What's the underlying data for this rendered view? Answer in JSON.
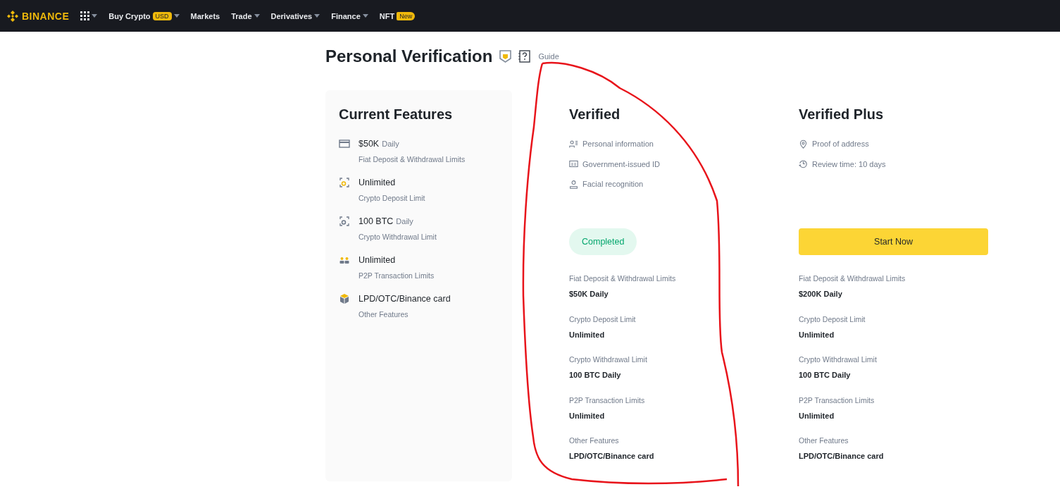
{
  "navbar": {
    "logo": "BINANCE",
    "items": [
      {
        "kind": "apps",
        "caret": true
      },
      {
        "kind": "link",
        "label": "Buy Crypto",
        "badge": "USD",
        "caret": true
      },
      {
        "kind": "link",
        "label": "Markets",
        "caret": false
      },
      {
        "kind": "link",
        "label": "Trade",
        "caret": true
      },
      {
        "kind": "link",
        "label": "Derivatives",
        "caret": true
      },
      {
        "kind": "link",
        "label": "Finance",
        "caret": true
      },
      {
        "kind": "link",
        "label": "NFT",
        "badge": "New",
        "caret": false
      }
    ]
  },
  "page": {
    "title": "Personal Verification",
    "guide": "Guide"
  },
  "current": {
    "title": "Current Features",
    "items": [
      {
        "value": "$50K",
        "suffix": "Daily",
        "label": "Fiat Deposit & Withdrawal Limits"
      },
      {
        "value": "Unlimited",
        "label": "Crypto Deposit Limit"
      },
      {
        "value": "100 BTC",
        "suffix": "Daily",
        "label": "Crypto Withdrawal Limit"
      },
      {
        "value": "Unlimited",
        "label": "P2P Transaction Limits"
      },
      {
        "value": "LPD/OTC/Binance card",
        "label": "Other Features"
      }
    ]
  },
  "levels": [
    {
      "title": "Verified",
      "requirements": [
        {
          "text": "Personal information"
        },
        {
          "text": "Government-issued ID"
        },
        {
          "text": "Facial recognition"
        }
      ],
      "action": {
        "kind": "status",
        "label": "Completed"
      },
      "limits": [
        {
          "label": "Fiat Deposit & Withdrawal Limits",
          "value": "$50K Daily"
        },
        {
          "label": "Crypto Deposit Limit",
          "value": "Unlimited"
        },
        {
          "label": "Crypto Withdrawal Limit",
          "value": "100 BTC Daily"
        },
        {
          "label": "P2P Transaction Limits",
          "value": "Unlimited"
        },
        {
          "label": "Other Features",
          "value": "LPD/OTC/Binance card"
        }
      ]
    },
    {
      "title": "Verified Plus",
      "requirements": [
        {
          "text": "Proof of address"
        },
        {
          "text": "Review time: 10 days"
        }
      ],
      "action": {
        "kind": "button",
        "label": "Start Now"
      },
      "limits": [
        {
          "label": "Fiat Deposit & Withdrawal Limits",
          "value": "$200K Daily"
        },
        {
          "label": "Crypto Deposit Limit",
          "value": "Unlimited"
        },
        {
          "label": "Crypto Withdrawal Limit",
          "value": "100 BTC Daily"
        },
        {
          "label": "P2P Transaction Limits",
          "value": "Unlimited"
        },
        {
          "label": "Other Features",
          "value": "LPD/OTC/Binance card"
        }
      ]
    }
  ],
  "annotation": {
    "kind": "freehand-loop",
    "color": "#e8141b"
  }
}
